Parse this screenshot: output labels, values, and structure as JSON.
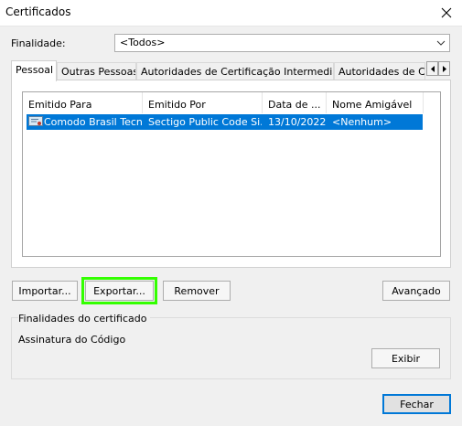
{
  "window": {
    "title": "Certificados"
  },
  "finalidade": {
    "label": "Finalidade:",
    "value": "<Todos>"
  },
  "tabs": [
    "Pessoal",
    "Outras Pessoas",
    "Autoridades de Certificação Intermediárias",
    "Autoridades de Ce"
  ],
  "list": {
    "columns": [
      "Emitido Para",
      "Emitido Por",
      "Data de ...",
      "Nome Amigável"
    ],
    "rows": [
      {
        "issued_to": "Comodo Brasil Tecn...",
        "issued_by": "Sectigo Public Code Si...",
        "date": "13/10/2022",
        "friendly": "<Nenhum>",
        "icon": "certificate-icon"
      }
    ]
  },
  "buttons": {
    "import": "Importar...",
    "export": "Exportar...",
    "remove": "Remover",
    "advanced": "Avançado",
    "view": "Exibir",
    "close": "Fechar"
  },
  "purposes": {
    "heading": "Finalidades do certificado",
    "value": "Assinatura do Código"
  },
  "colors": {
    "selection": "#0078d7",
    "highlight": "#33ff00",
    "default_border": "#0078d7"
  }
}
